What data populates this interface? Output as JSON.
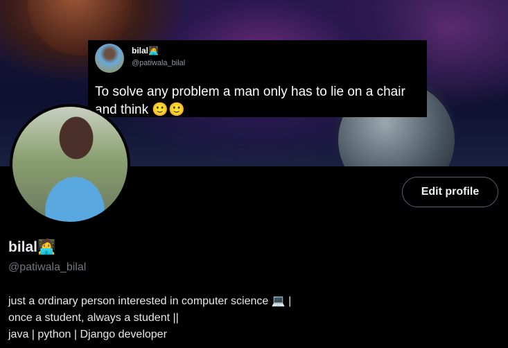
{
  "banner": {
    "tweet": {
      "name": "bilal",
      "name_emoji": "🧑‍💻",
      "handle": "@patiwala_bilal",
      "text": "To solve any problem a man only has to lie on a chair and think 🙂🙂"
    }
  },
  "profile": {
    "name": "bilal",
    "name_emoji": "🧑‍💻",
    "handle": "@patiwala_bilal",
    "edit_label": "Edit profile",
    "bio": [
      "just a ordinary person interested in computer science 💻 |",
      "once a student, always a student ||",
      "java | python | Django developer"
    ]
  }
}
